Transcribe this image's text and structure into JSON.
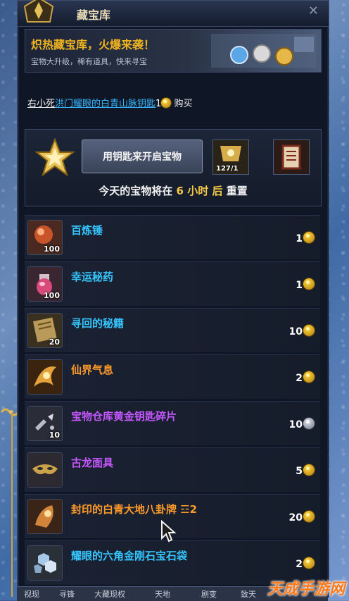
{
  "window": {
    "title": "藏宝库"
  },
  "banner": {
    "headline": "炽热藏宝库，火爆来袭！",
    "subtitle": "宝物大升级，稀有道具，快来寻宝"
  },
  "buy_line": {
    "prefix": "右小死",
    "key_name": "洪门耀眼的白青山脉钥匙",
    "qty": "1",
    "action": "购买"
  },
  "action_box": {
    "open_button": "用钥匙来开启宝物",
    "slot1_count": "127/1",
    "reset_prefix": "今天的宝物将在",
    "reset_hours": "6",
    "reset_unit": "小时",
    "reset_after": "后",
    "reset_suffix": "重置"
  },
  "items": [
    {
      "name": "百炼锤",
      "color": "#36c6ff",
      "count": "100",
      "price": "1",
      "currency": "gold",
      "icon": "hammer-icon"
    },
    {
      "name": "幸运秘药",
      "color": "#36c6ff",
      "count": "100",
      "price": "1",
      "currency": "gold",
      "icon": "potion-icon"
    },
    {
      "name": "寻回的秘籍",
      "color": "#36c6ff",
      "count": "20",
      "price": "10",
      "currency": "gold",
      "icon": "scroll-icon"
    },
    {
      "name": "仙界气息",
      "color": "#ff9a2a",
      "count": "",
      "price": "2",
      "currency": "gold",
      "icon": "aura-icon"
    },
    {
      "name": "宝物仓库黄金钥匙碎片",
      "color": "#c457ff",
      "count": "10",
      "price": "10",
      "currency": "silver",
      "icon": "key-fragment-icon"
    },
    {
      "name": "古龙面具",
      "color": "#c457ff",
      "count": "",
      "price": "5",
      "currency": "gold",
      "icon": "mask-icon"
    },
    {
      "name": "封印的白青大地八卦牌 ☲2",
      "color": "#ff9a2a",
      "count": "",
      "price": "20",
      "currency": "gold",
      "icon": "talisman-icon"
    },
    {
      "name": "耀眼的六角金刚石宝石袋",
      "color": "#36c6ff",
      "count": "",
      "price": "2",
      "currency": "gold",
      "icon": "gem-bag-icon"
    }
  ],
  "bottom_tabs": [
    "视现",
    "寻锋",
    "大藏现权",
    "天地",
    "剧变",
    "致天"
  ],
  "watermark": "天成手游网"
}
